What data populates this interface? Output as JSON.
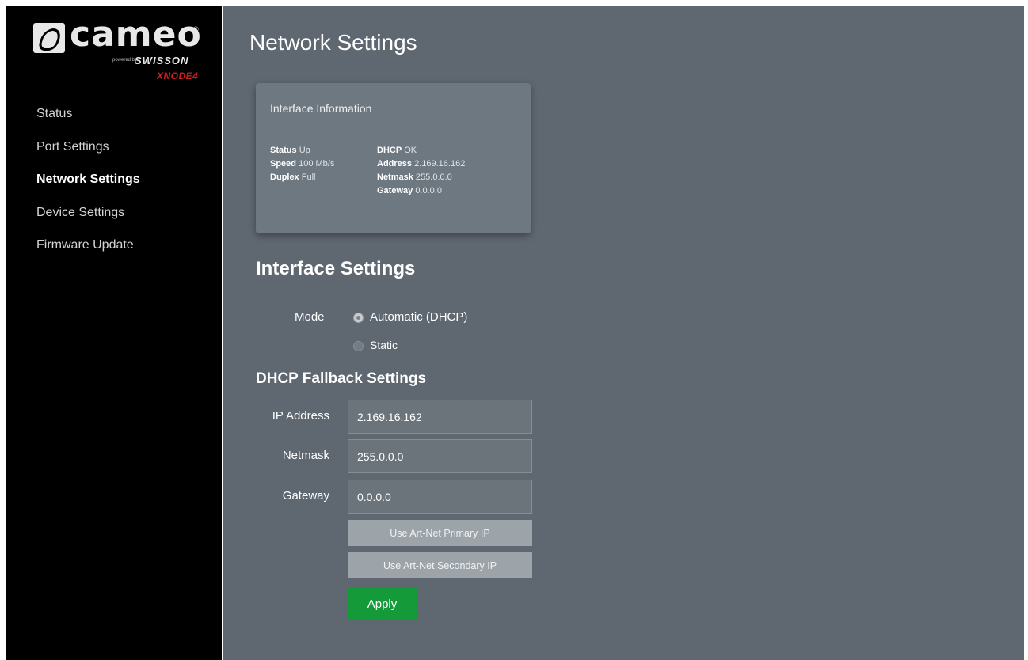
{
  "brand": {
    "name": "cameo",
    "registered": "®",
    "powered_by": "powered by",
    "partner": "SWISSON",
    "model": "XNODE4"
  },
  "sidebar": {
    "items": [
      {
        "label": "Status",
        "active": false
      },
      {
        "label": "Port Settings",
        "active": false
      },
      {
        "label": "Network Settings",
        "active": true
      },
      {
        "label": "Device Settings",
        "active": false
      },
      {
        "label": "Firmware Update",
        "active": false
      }
    ]
  },
  "page": {
    "title": "Network Settings"
  },
  "interface_info": {
    "title": "Interface Information",
    "status_label": "Status",
    "status_value": "Up",
    "speed_label": "Speed",
    "speed_value": "100 Mb/s",
    "duplex_label": "Duplex",
    "duplex_value": "Full",
    "dhcp_label": "DHCP",
    "dhcp_value": "OK",
    "address_label": "Address",
    "address_value": "2.169.16.162",
    "netmask_label": "Netmask",
    "netmask_value": "255.0.0.0",
    "gateway_label": "Gateway",
    "gateway_value": "0.0.0.0"
  },
  "interface_settings": {
    "title": "Interface Settings",
    "mode_label": "Mode",
    "options": [
      {
        "label": "Automatic (DHCP)",
        "selected": true
      },
      {
        "label": "Static",
        "selected": false
      }
    ]
  },
  "dhcp_fallback": {
    "title": "DHCP Fallback Settings",
    "ip_label": "IP Address",
    "ip_value": "2.169.16.162",
    "netmask_label": "Netmask",
    "netmask_value": "255.0.0.0",
    "gateway_label": "Gateway",
    "gateway_value": "0.0.0.0",
    "primary_button": "Use Art-Net Primary IP",
    "secondary_button": "Use Art-Net Secondary IP",
    "apply_button": "Apply"
  },
  "colors": {
    "sidebar_bg": "#000000",
    "main_bg": "#5f6770",
    "card_bg": "#6d7881",
    "apply_green": "#159a3a",
    "brand_red": "#d01c1c"
  }
}
